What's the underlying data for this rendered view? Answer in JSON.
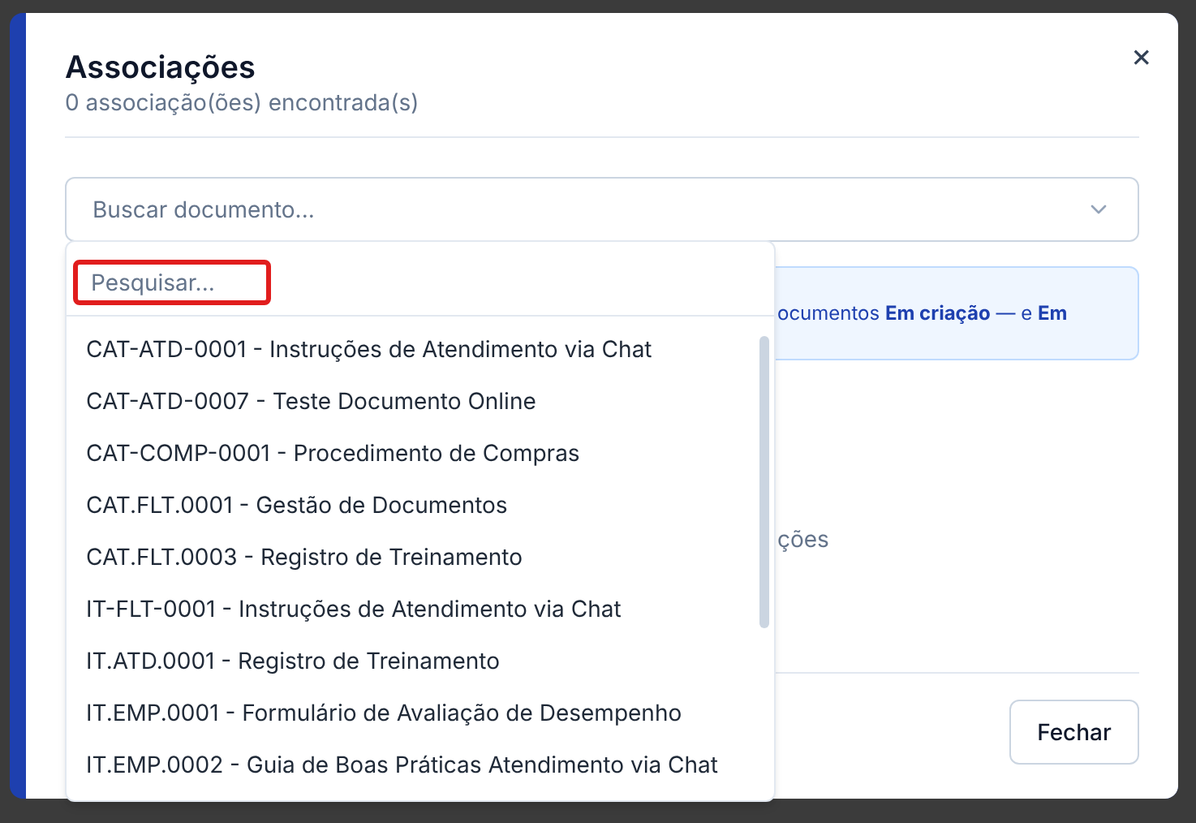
{
  "dialog": {
    "title": "Associações",
    "subtitle": "0 associação(ões) encontrada(s)",
    "close": "×"
  },
  "select": {
    "placeholder": "Buscar documento...",
    "expanded": true
  },
  "info_text": "ocumentos **Em criação** — e **Em**",
  "empty_text": "ções",
  "dropdown": {
    "search_placeholder": "Pesquisar...",
    "highlighted": true,
    "options": [
      {
        "label": "CAT-ATD-0001 - Instruções de Atendimento via Chat"
      },
      {
        "label": "CAT-ATD-0007 - Teste Documento Online"
      },
      {
        "label": "CAT-COMP-0001 - Procedimento de Compras"
      },
      {
        "label": "CAT.FLT.0001 - Gestão de Documentos"
      },
      {
        "label": "CAT.FLT.0003 - Registro de Treinamento"
      },
      {
        "label": "IT-FLT-0001 - Instruções de Atendimento via Chat"
      },
      {
        "label": "IT.ATD.0001 - Registro de Treinamento"
      },
      {
        "label": "IT.EMP.0001 - Formulário de Avaliação de Desempenho"
      },
      {
        "label": "IT.EMP.0002 - Guia de Boas Práticas Atendimento via Chat"
      }
    ]
  },
  "footer": {
    "close_button": "Fechar"
  }
}
